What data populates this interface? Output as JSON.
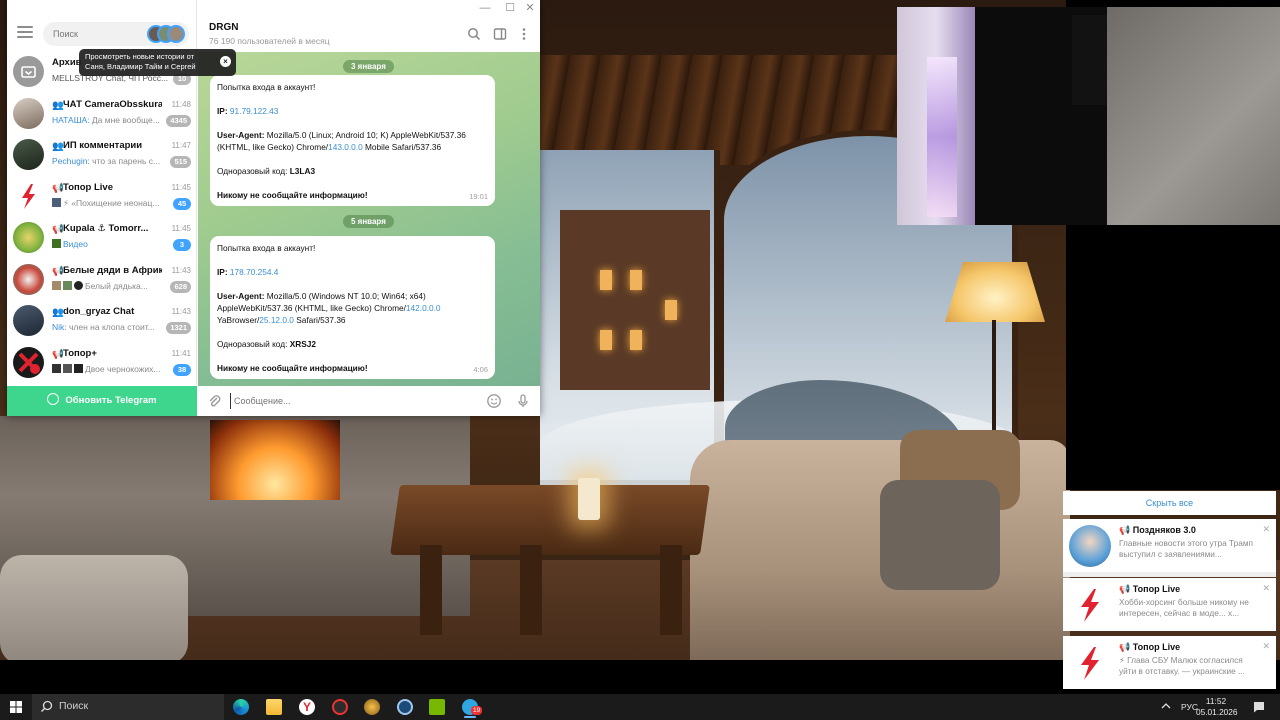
{
  "telegram": {
    "search_placeholder": "Поиск",
    "tooltip": "Просмотреть новые истории от Саня, Владимир Тайм и Сергей",
    "tooltip_close": "×",
    "update_button": "Обновить Telegram",
    "chats": [
      {
        "name": "Архив",
        "time": "",
        "preview": "MELLSTROY Chat, ЧП Росс...",
        "sender": "",
        "badge": "10",
        "badge_style": "muted",
        "avatar_color": "#8f8f8f"
      },
      {
        "name": "ЧАТ CameraObsskura",
        "time": "11:48",
        "sender": "НАТАША:",
        "preview": " Да мне вообще...",
        "badge": "4345",
        "badge_style": "muted",
        "avatar_color": "#7b6a5e"
      },
      {
        "name": "ИП комментарии",
        "time": "11:47",
        "sender": "Pechugin:",
        "preview": " что за парень с...",
        "badge": "515",
        "badge_style": "muted",
        "avatar_color": "#2f3b2e"
      },
      {
        "name": "Топор Live",
        "time": "11:45",
        "sender": "",
        "preview": "⚡ «Похищение неонац...",
        "badge": "45",
        "badge_style": "blue",
        "avatar_color": "#ffffff"
      },
      {
        "name": "Kupala ⚓ Tomorr...",
        "time": "11:45",
        "sender": "",
        "preview": "Видео",
        "badge": "3",
        "badge_style": "blue",
        "avatar_color": "#7fb23f"
      },
      {
        "name": "Белые дяди в Африке...",
        "time": "11:43",
        "sender": "",
        "preview": "Белый дядька...",
        "badge": "628",
        "badge_style": "muted",
        "avatar_color": "#c9483b"
      },
      {
        "name": "don_gryaz Chat",
        "time": "11:43",
        "sender": "Nik:",
        "preview": " член на клопа стоит...",
        "badge": "1321",
        "badge_style": "muted",
        "avatar_color": "#2f3f52"
      },
      {
        "name": "Топор+",
        "time": "11:41",
        "sender": "",
        "preview": "Двое чернокожих...",
        "badge": "38",
        "badge_style": "blue",
        "avatar_color": "#1a1a1a"
      }
    ],
    "chat": {
      "title": "DRGN",
      "subtitle": "76 190 пользователей в месяц",
      "composer_placeholder": "Сообщение...",
      "messages": [
        {
          "date": "3 января",
          "line1": "Попытка входа в аккаунт!",
          "ip_label": "IP:",
          "ip": "91.79.122.43",
          "ua_label": "User-Agent:",
          "ua_part1": " Mozilla/5.0 (Linux; Android 10; K) AppleWebKit/537.36 (KHTML, like Gecko) Chrome/",
          "ua_link": "143.0.0.0",
          "ua_part2": " Mobile Safari/537.36",
          "code_label": "Одноразовый код:",
          "code": "L3LA3",
          "warning": "Никому не сообщайте информацию!",
          "time": "19:01"
        },
        {
          "date": "5 января",
          "line1": "Попытка входа в аккаунт!",
          "ip_label": "IP:",
          "ip": "178.70.254.4",
          "ua_label": "User-Agent:",
          "ua_part1": " Mozilla/5.0 (Windows NT 10.0; Win64; x64) AppleWebKit/537.36 (KHTML, like Gecko) Chrome/",
          "ua_link": "142.0.0.0",
          "ua_part2a": " YaBrowser/",
          "ua_link2": "25.12.0.0",
          "ua_part2": " Safari/537.36",
          "code_label": "Одноразовый код:",
          "code": "XRSJ2",
          "warning": "Никому не сообщайте информацию!",
          "time": "4:06"
        }
      ]
    }
  },
  "notifications": {
    "hide_all": "Скрыть все",
    "items": [
      {
        "title": "Поздняков 3.0",
        "text": "Главные новости этого утра Трамп выступил с заявлениями...",
        "avatar_color": "#5aa0d8"
      },
      {
        "title": "Топор Live",
        "text": "Хобби-хорсинг больше никому не интересен, сейчас в моде... х...",
        "avatar_color": "#ffffff"
      },
      {
        "title": "Топор Live",
        "text": "⚡ Глава СБУ Малюк согласился уйти в отставку. — украинские ...",
        "avatar_color": "#ffffff"
      }
    ]
  },
  "taskbar": {
    "search_label": "Поиск",
    "lang": "РУС",
    "time": "11:52",
    "date": "05.01.2026",
    "tg_badge": "19"
  },
  "colors": {
    "telegram_accent": "#3a8ed3",
    "update_green": "#3dd68c",
    "badge_blue": "#3fa3ff",
    "topor_red": "#e0232e"
  }
}
